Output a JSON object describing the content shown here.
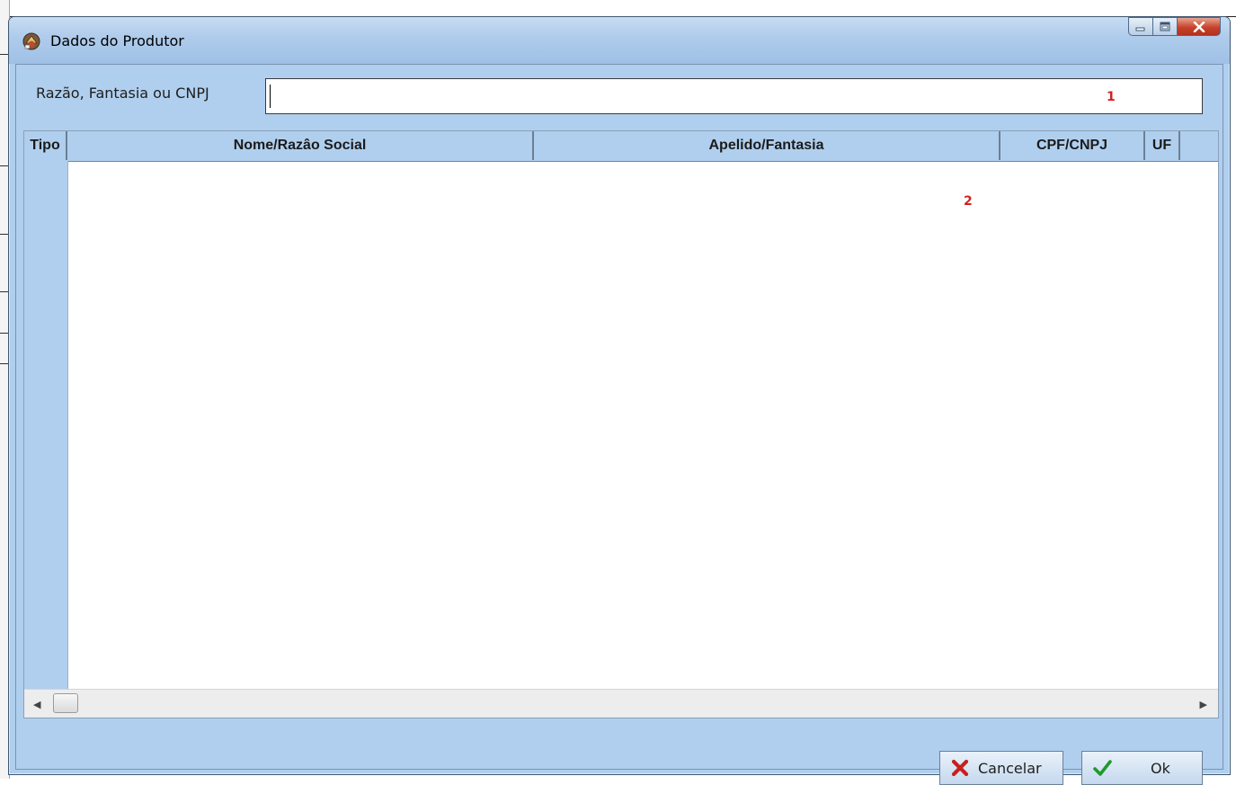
{
  "window": {
    "title": "Dados do Produtor",
    "controls": {
      "minimize": "minimize",
      "maximize": "maximize",
      "close": "close"
    }
  },
  "search": {
    "label": "Razão, Fantasia ou CNPJ",
    "value": "",
    "marker": "1"
  },
  "grid": {
    "columns": [
      "Tipo",
      "Nome/Razâo Social",
      "Apelido/Fantasia",
      "CPF/CNPJ",
      "UF"
    ],
    "rows": [],
    "marker": "2"
  },
  "buttons": {
    "cancel": "Cancelar",
    "ok": "Ok"
  },
  "colors": {
    "window_bg": "#b0cfee",
    "marker_red": "#d42020",
    "close_red": "#c7432a"
  }
}
